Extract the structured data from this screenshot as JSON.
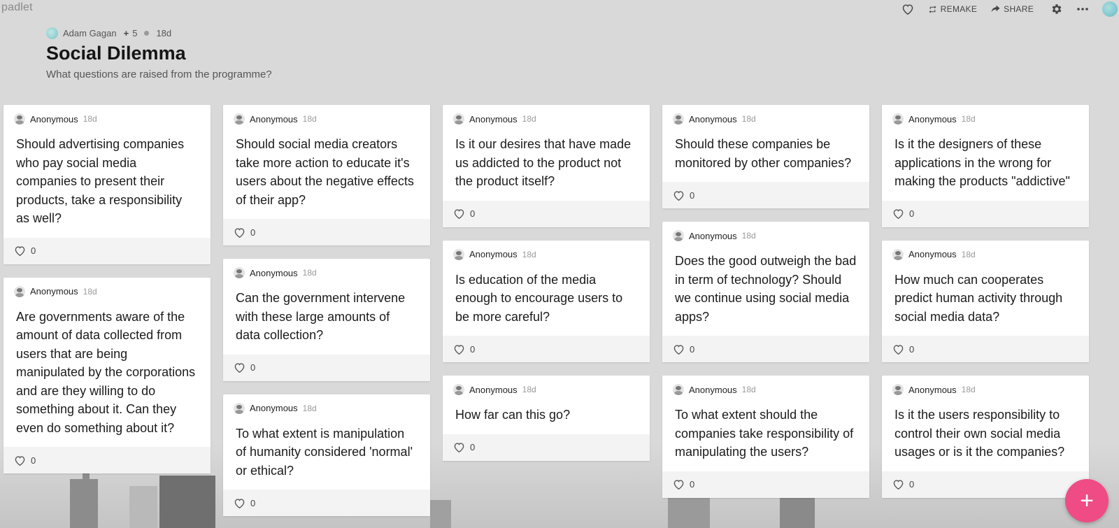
{
  "app": {
    "logo": "padlet"
  },
  "toolbar": {
    "remake_label": "REMAKE",
    "share_label": "SHARE"
  },
  "board": {
    "owner": "Adam Gagan",
    "contributors": "5",
    "age": "18d",
    "title": "Social Dilemma",
    "subtitle": "What questions are raised from the programme?"
  },
  "columns": [
    {
      "posts": [
        {
          "author": "Anonymous",
          "age": "18d",
          "text": "Should advertising companies who pay social media companies to present their products, take a responsibility as well?",
          "likes": "0"
        },
        {
          "author": "Anonymous",
          "age": "18d",
          "text": "Are governments aware of the amount of data collected from users that are being manipulated by the corporations and are they willing to do something about it. Can they even do something about it?",
          "likes": "0"
        }
      ]
    },
    {
      "posts": [
        {
          "author": "Anonymous",
          "age": "18d",
          "text": "Should social media creators take more action to educate it's users about the negative effects of their app?",
          "likes": "0"
        },
        {
          "author": "Anonymous",
          "age": "18d",
          "text": "Can the government intervene with these large amounts of data collection?",
          "likes": "0"
        },
        {
          "author": "Anonymous",
          "age": "18d",
          "text": "To what extent is manipulation of humanity considered 'normal' or ethical?",
          "likes": "0"
        }
      ]
    },
    {
      "posts": [
        {
          "author": "Anonymous",
          "age": "18d",
          "text": "Is it our desires that have made us addicted to the product not the product itself?",
          "likes": "0"
        },
        {
          "author": "Anonymous",
          "age": "18d",
          "text": "Is education of the media enough to encourage users to be more careful?",
          "likes": "0"
        },
        {
          "author": "Anonymous",
          "age": "18d",
          "text": "How far can this go?",
          "likes": "0"
        }
      ]
    },
    {
      "posts": [
        {
          "author": "Anonymous",
          "age": "18d",
          "text": "Should these companies be monitored by other companies?",
          "likes": "0"
        },
        {
          "author": "Anonymous",
          "age": "18d",
          "text": "Does the good outweigh the bad in term of technology? Should we continue using social media apps?",
          "likes": "0"
        },
        {
          "author": "Anonymous",
          "age": "18d",
          "text": "To what extent should the companies take responsibility of manipulating the users?",
          "likes": "0"
        }
      ]
    },
    {
      "posts": [
        {
          "author": "Anonymous",
          "age": "18d",
          "text": "Is it the designers of these applications in the wrong for making the products \"addictive\"",
          "likes": "0"
        },
        {
          "author": "Anonymous",
          "age": "18d",
          "text": "How much can cooperates predict human activity through social media data?",
          "likes": "0"
        },
        {
          "author": "Anonymous",
          "age": "18d",
          "text": "Is it the users responsibility to control their own social media usages or is it the companies?",
          "likes": "0"
        }
      ]
    }
  ],
  "fab": {
    "label": "+"
  },
  "colors": {
    "fab": "#ef4b85",
    "background": "#d9d9d9"
  }
}
